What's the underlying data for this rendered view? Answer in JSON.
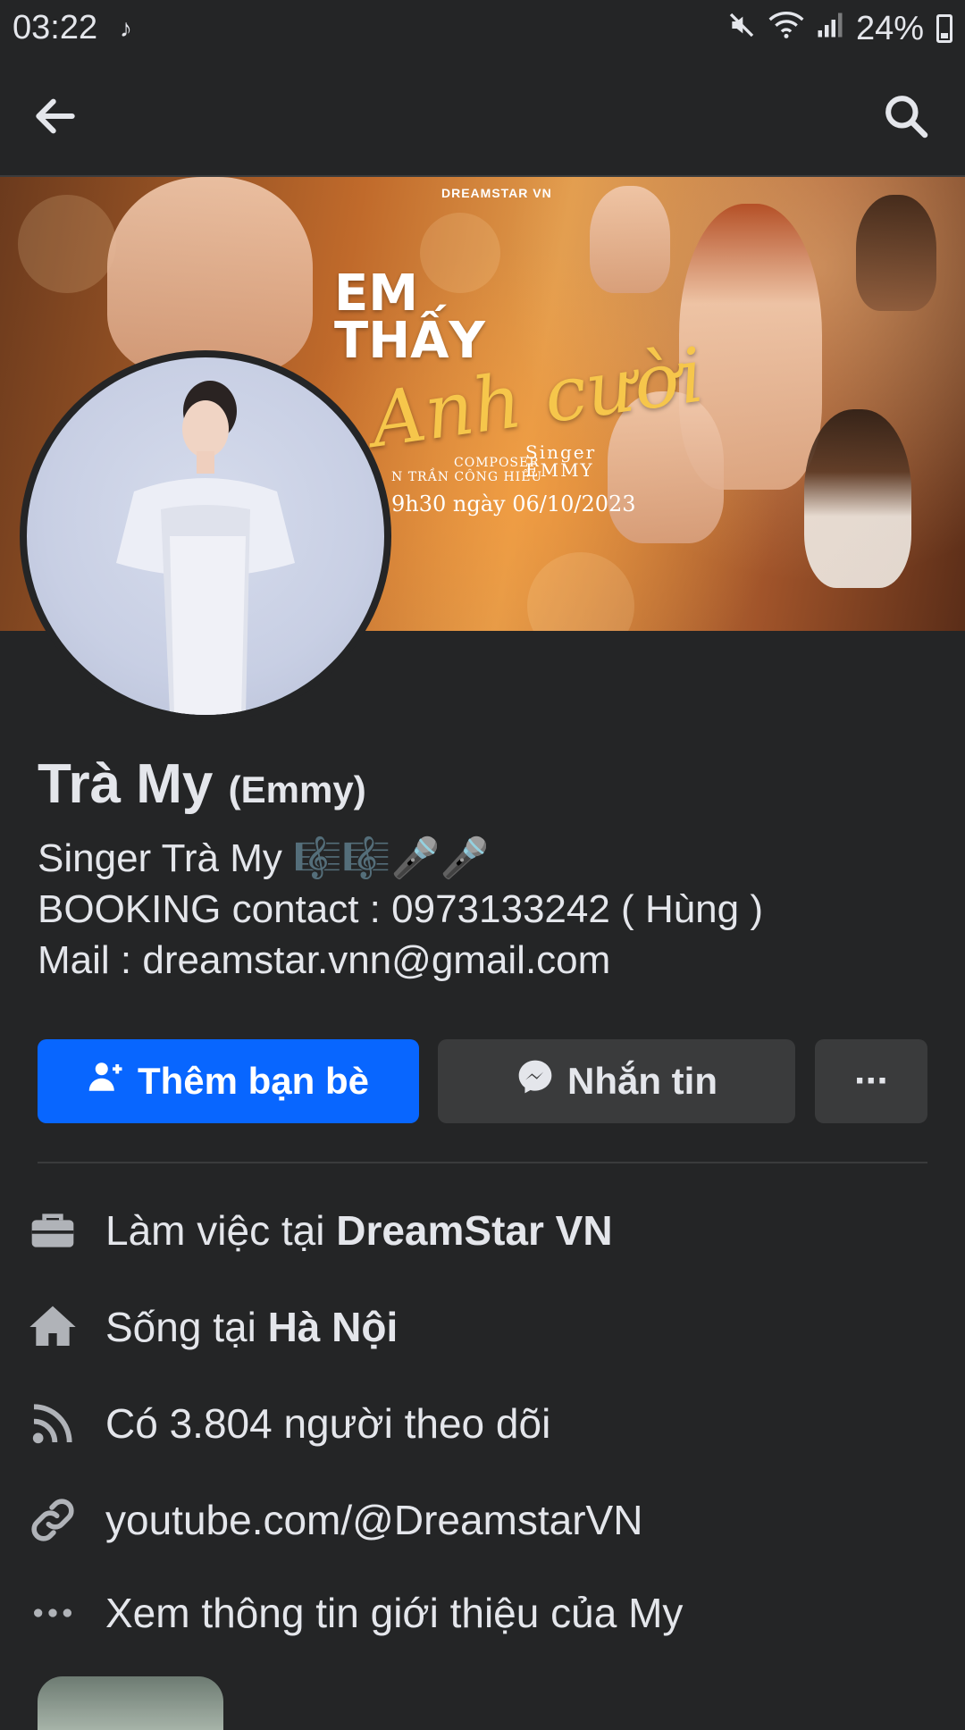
{
  "status_bar": {
    "time": "03:22",
    "battery": "24%",
    "icons": [
      "tiktok-icon",
      "mute-icon",
      "wifi-icon",
      "signal-icon",
      "battery-icon"
    ]
  },
  "app_bar": {
    "back_icon": "arrow-left-icon",
    "search_icon": "search-icon"
  },
  "cover": {
    "brand": "DREAMSTAR VN",
    "title_line1": "EM",
    "title_line2": "THẤY",
    "title_script": "Anh cười",
    "composer": "COMPOSER",
    "composer_name": "N TRẦN CÔNG HIẾU",
    "singer_label": "Singer",
    "singer_name": "EMMY",
    "date_line": "9h30 ngày 06/10/2023"
  },
  "profile": {
    "name": "Trà My",
    "alt_name": "(Emmy)",
    "bio_line1": " Singer Trà My 🎼🎼🎤🎤",
    "bio_line2": "BOOKING contact : 0973133242 ( Hùng )",
    "bio_line3": "Mail : dreamstar.vnn@gmail.com"
  },
  "actions": {
    "add_friend": "Thêm bạn bè",
    "message": "Nhắn tin",
    "more": "···"
  },
  "details": [
    {
      "icon": "briefcase-icon",
      "prefix": "Làm việc tại ",
      "bold": "DreamStar VN"
    },
    {
      "icon": "home-icon",
      "prefix": "Sống tại ",
      "bold": "Hà Nội"
    },
    {
      "icon": "rss-icon",
      "prefix": "Có 3.804 người theo dõi",
      "bold": ""
    },
    {
      "icon": "link-icon",
      "prefix": "youtube.com/@DreamstarVN",
      "bold": ""
    },
    {
      "icon": "more-dots-icon",
      "prefix": "Xem thông tin giới thiệu của My",
      "bold": ""
    }
  ],
  "colors": {
    "background": "#242526",
    "primary_button": "#0866ff",
    "secondary_button": "#3a3b3c",
    "text": "#e4e6eb"
  }
}
